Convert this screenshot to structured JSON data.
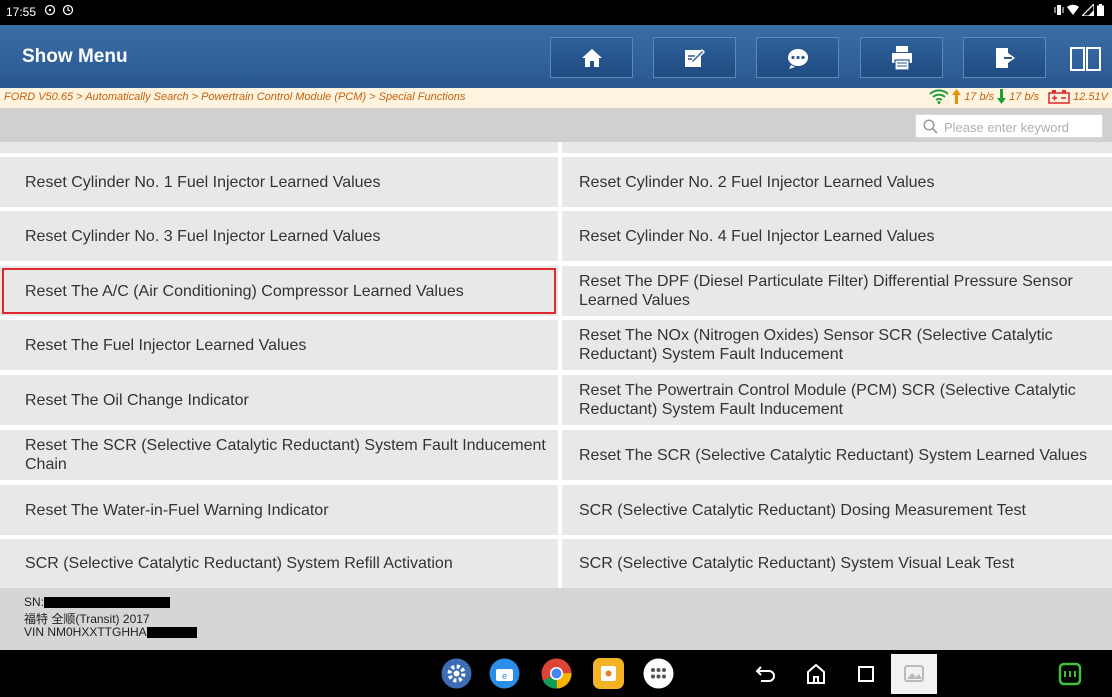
{
  "status_bar": {
    "time": "17:55",
    "notif_icons": [
      "message-icon",
      "settings-badge-icon"
    ],
    "right_icons": [
      "vibrate-icon",
      "wifi-icon",
      "signal-icon",
      "battery-icon"
    ]
  },
  "header": {
    "title": "Show Menu",
    "buttons": [
      {
        "name": "home-button",
        "icon": "home-icon"
      },
      {
        "name": "edit-button",
        "icon": "edit-icon"
      },
      {
        "name": "message-button",
        "icon": "chat-icon"
      },
      {
        "name": "print-button",
        "icon": "printer-icon"
      },
      {
        "name": "exit-button",
        "icon": "exit-icon"
      }
    ],
    "split_icon": "split-view-icon"
  },
  "breadcrumb": {
    "path": "FORD V50.65 > Automatically Search > Powertrain Control Module (PCM) > Special Functions",
    "upload": "17 b/s",
    "download": "17 b/s",
    "voltage": "12.51V"
  },
  "search": {
    "placeholder": "Please enter keyword"
  },
  "menu": {
    "rows": [
      {
        "left": "Reset Cylinder No. 1 Fuel Injector Learned Values",
        "right": "Reset Cylinder No. 2 Fuel Injector Learned Values"
      },
      {
        "left": "Reset Cylinder No. 3 Fuel Injector Learned Values",
        "right": "Reset Cylinder No. 4 Fuel Injector Learned Values"
      },
      {
        "left": "Reset The A/C (Air Conditioning) Compressor Learned Values",
        "right": "Reset The DPF (Diesel Particulate Filter) Differential Pressure Sensor Learned Values"
      },
      {
        "left": "Reset The Fuel Injector Learned Values",
        "right": "Reset The NOx (Nitrogen Oxides) Sensor SCR (Selective Catalytic Reductant) System Fault Inducement"
      },
      {
        "left": "Reset The Oil Change Indicator",
        "right": "Reset The Powertrain Control Module (PCM) SCR (Selective Catalytic Reductant) System Fault Inducement"
      },
      {
        "left": "Reset The SCR (Selective Catalytic Reductant) System Fault Inducement Chain",
        "right": "Reset The SCR (Selective Catalytic Reductant) System Learned Values"
      },
      {
        "left": "Reset The Water-in-Fuel Warning Indicator",
        "right": "SCR (Selective Catalytic Reductant) Dosing Measurement Test"
      },
      {
        "left": "SCR (Selective Catalytic Reductant) System Refill Activation",
        "right": "SCR (Selective Catalytic Reductant) System Visual Leak Test"
      }
    ],
    "selected": "Reset The A/C (Air Conditioning) Compressor Learned Values",
    "selected_color": "#e0262e"
  },
  "vehicle_info": {
    "sn_label": "SN:",
    "model": "福特 全顺(Transit) 2017",
    "vin_label": "VIN NM0HXXTTGHHA"
  },
  "nav_bar": {
    "apps": [
      "settings-app-icon",
      "browser-app-icon",
      "chrome-app-icon",
      "diagnostic-app-icon",
      "app-drawer-icon"
    ],
    "system": [
      "back-icon",
      "home-nav-icon",
      "recents-icon",
      "gallery-icon",
      "vci-icon"
    ]
  },
  "colors": {
    "header": "#2f619a",
    "breadcrumb_text": "#c4610c",
    "cell_bg": "#e8e8e8",
    "upload_arrow": "#e8920c",
    "download_arrow": "#1e9e3a"
  }
}
